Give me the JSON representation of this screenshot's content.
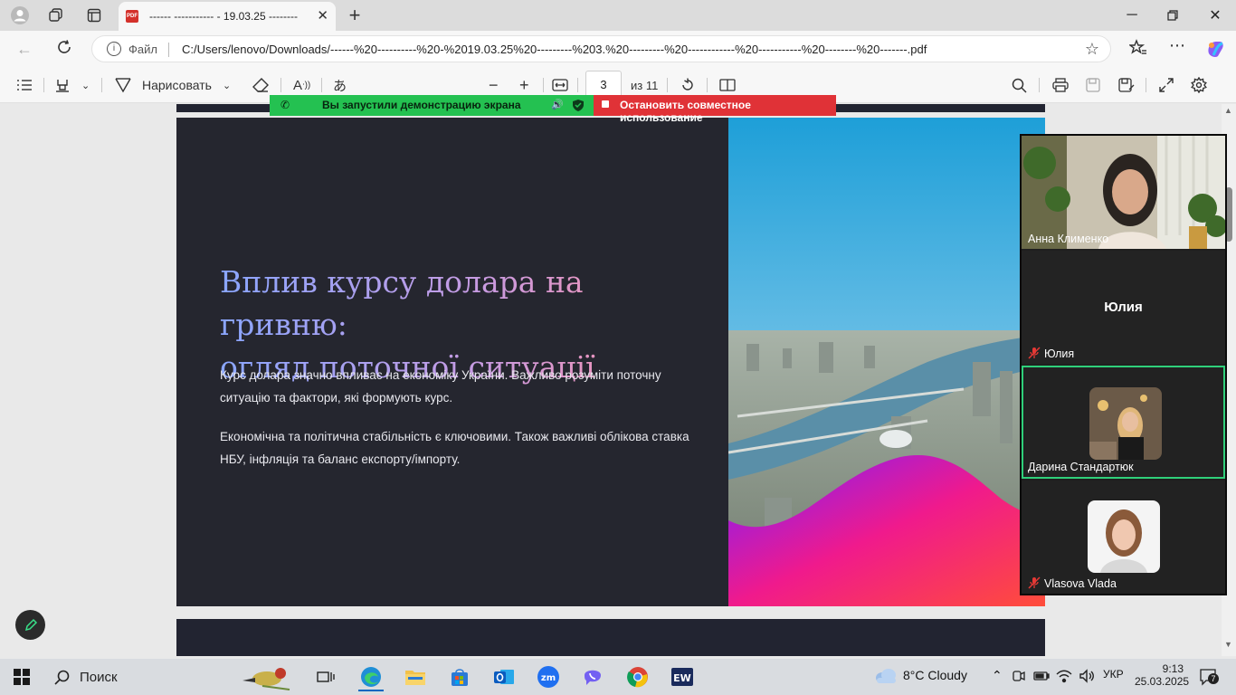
{
  "browser": {
    "tab_title": "------ ----------- - 19.03.25 --------",
    "address_scheme": "Файл",
    "url": "C:/Users/lenovo/Downloads/------%20----------%20-%2019.03.25%20---------%203.%20---------%20------------%20-----------%20--------%20-------.pdf"
  },
  "pdf_toolbar": {
    "draw_label": "Нарисовать",
    "page_current": "3",
    "page_total": "из 11"
  },
  "share_banner": {
    "status": "Вы запустили демонстрацию экрана",
    "stop": "Остановить совместное использование"
  },
  "slide": {
    "title_line1": "Вплив курсу долара на гривню:",
    "title_line2": "огляд поточної ситуації",
    "para1": "Курс долара значно впливає на економіку України. Важливо розуміти поточну ситуацію та фактори, які формують курс.",
    "para2": "Економічна та політична стабільність є ключовими. Також важливі облікова ставка НБУ, інфляція та баланс експорту/імпорту."
  },
  "participants": [
    {
      "name": "Анна Клименко",
      "muted": false
    },
    {
      "name": "Юлия",
      "display": "Юлия",
      "muted": true
    },
    {
      "name": "Дарина Стандартюк",
      "muted": false,
      "active": true
    },
    {
      "name": "Vlasova Vlada",
      "muted": true
    }
  ],
  "taskbar": {
    "search_label": "Поиск",
    "weather": "8°C  Cloudy",
    "language": "УКР",
    "time": "9:13",
    "date": "25.03.2025",
    "notifications": "7"
  }
}
